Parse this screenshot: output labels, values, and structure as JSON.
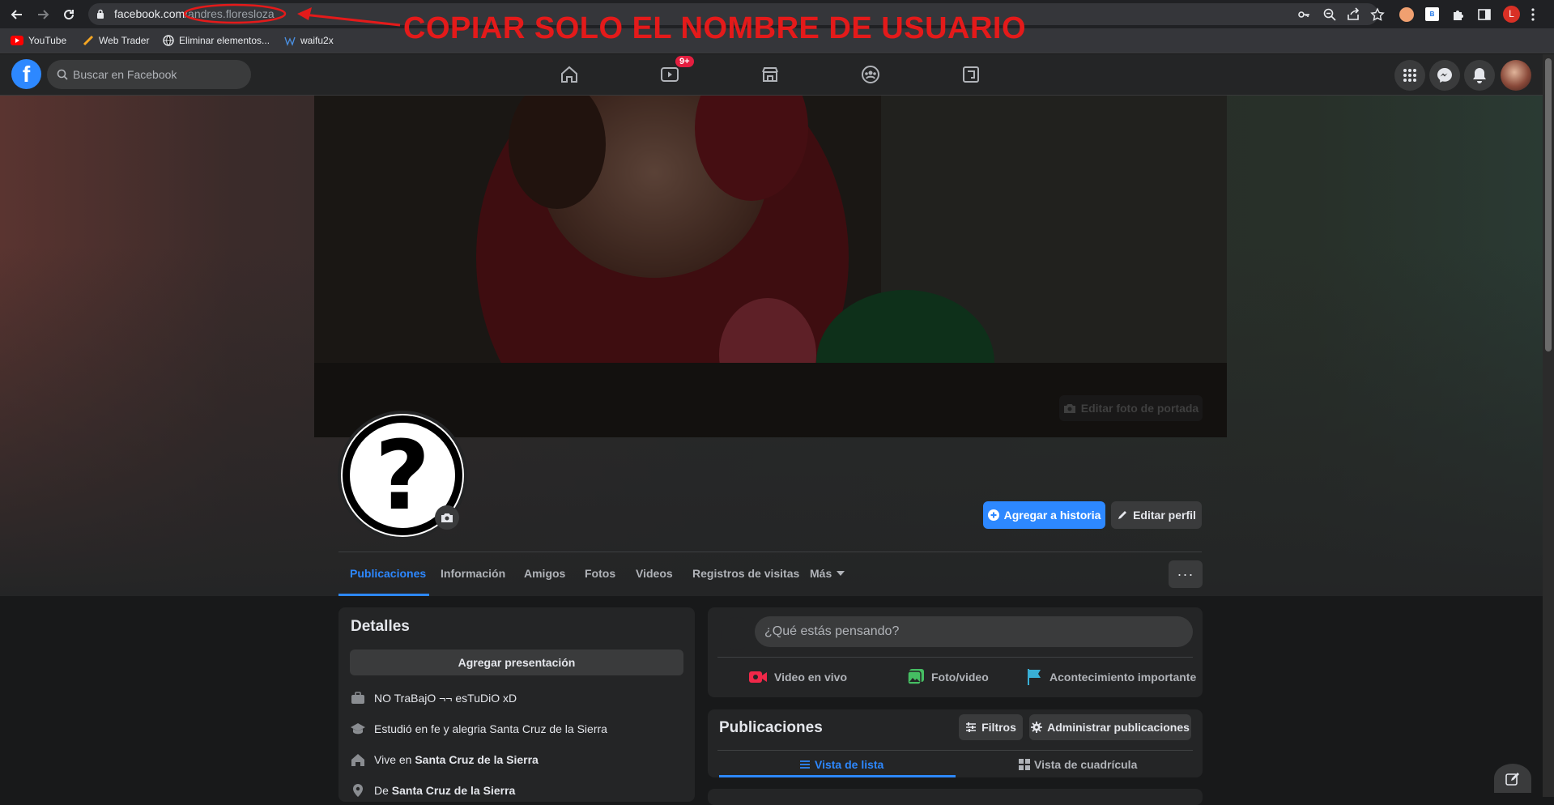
{
  "browser": {
    "url_host": "facebook.com",
    "url_path": "/andres.floresloza",
    "bookmarks": [
      {
        "label": "YouTube"
      },
      {
        "label": "Web Trader"
      },
      {
        "label": "Eliminar elementos..."
      },
      {
        "label": "waifu2x"
      }
    ],
    "profile_initial": "L"
  },
  "annotation": {
    "text": "COPIAR SOLO EL NOMBRE DE USUARIO",
    "color": "#e41a1a"
  },
  "fb_header": {
    "search_placeholder": "Buscar en Facebook",
    "video_badge": "9+"
  },
  "profile": {
    "edit_cover_label": "Editar foto de portada",
    "add_story_label": "Agregar a historia",
    "edit_profile_label": "Editar perfil",
    "tabs": [
      {
        "label": "Publicaciones"
      },
      {
        "label": "Información"
      },
      {
        "label": "Amigos"
      },
      {
        "label": "Fotos"
      },
      {
        "label": "Videos"
      },
      {
        "label": "Registros de visitas"
      },
      {
        "label": "Más"
      }
    ],
    "more_dots": "···"
  },
  "details": {
    "title": "Detalles",
    "add_presentation": "Agregar presentación",
    "work": "NO TraBajO ¬¬ esTuDiO xD",
    "study": "Estudió en fe y alegria Santa Cruz de la Sierra",
    "lives_prefix": "Vive en",
    "lives_place": "Santa Cruz de la Sierra",
    "from_prefix": "De",
    "from_place": "Santa Cruz de la Sierra"
  },
  "composer": {
    "placeholder": "¿Qué estás pensando?",
    "live_video": "Video en vivo",
    "photo_video": "Foto/video",
    "life_event": "Acontecimiento importante"
  },
  "posts": {
    "title": "Publicaciones",
    "filters": "Filtros",
    "manage": "Administrar publicaciones",
    "list_view": "Vista de lista",
    "grid_view": "Vista de cuadrícula"
  },
  "colors": {
    "fb_blue": "#2d88ff",
    "dark_bg": "#18191a",
    "card_bg": "#242526",
    "badge_red": "#e41e3f"
  }
}
